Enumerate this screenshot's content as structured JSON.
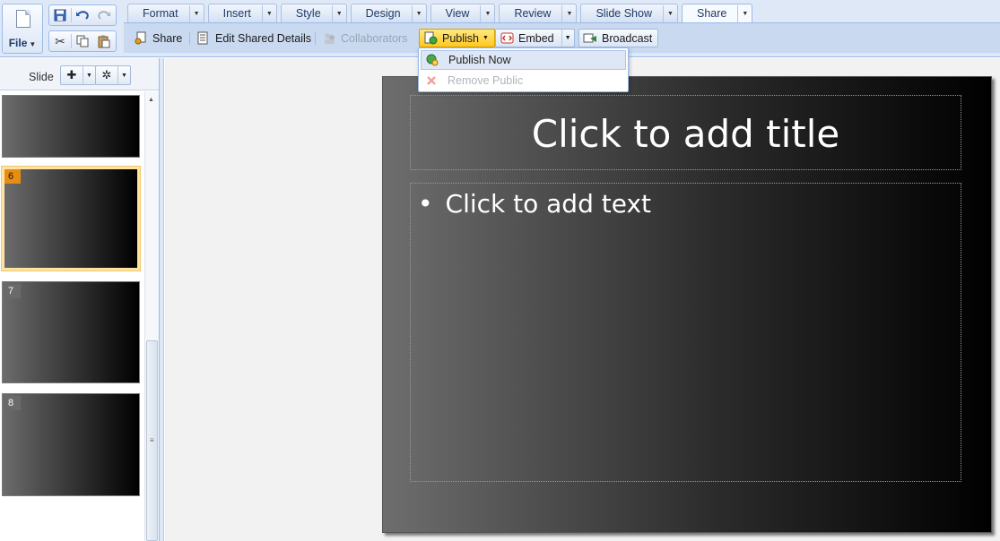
{
  "file_menu": {
    "label": "File"
  },
  "tabs": [
    {
      "label": "Format"
    },
    {
      "label": "Insert"
    },
    {
      "label": "Style"
    },
    {
      "label": "Design"
    },
    {
      "label": "View"
    },
    {
      "label": "Review"
    },
    {
      "label": "Slide Show"
    },
    {
      "label": "Share"
    }
  ],
  "active_tab": "Share",
  "ribbon": {
    "share": "Share",
    "edit_shared_details": "Edit Shared Details",
    "collaborators": "Collaborators",
    "publish": "Publish",
    "embed": "Embed",
    "broadcast": "Broadcast"
  },
  "publish_menu": {
    "items": [
      {
        "label": "Publish Now",
        "enabled": true
      },
      {
        "label": "Remove Public",
        "enabled": false
      }
    ]
  },
  "slide_panel": {
    "label": "Slide",
    "thumbnails": [
      {
        "number": ""
      },
      {
        "number": "6",
        "selected": true
      },
      {
        "number": "7"
      },
      {
        "number": "8"
      }
    ]
  },
  "slide": {
    "title_placeholder": "Click to add title",
    "body_placeholder": "Click to add text",
    "bullet": "•"
  },
  "colors": {
    "accent_blue": "#99bbe8",
    "toolbar_bg": "#dfe8f6",
    "publish_highlight": "#ffc820",
    "selected_slide_badge": "#e88d13"
  }
}
